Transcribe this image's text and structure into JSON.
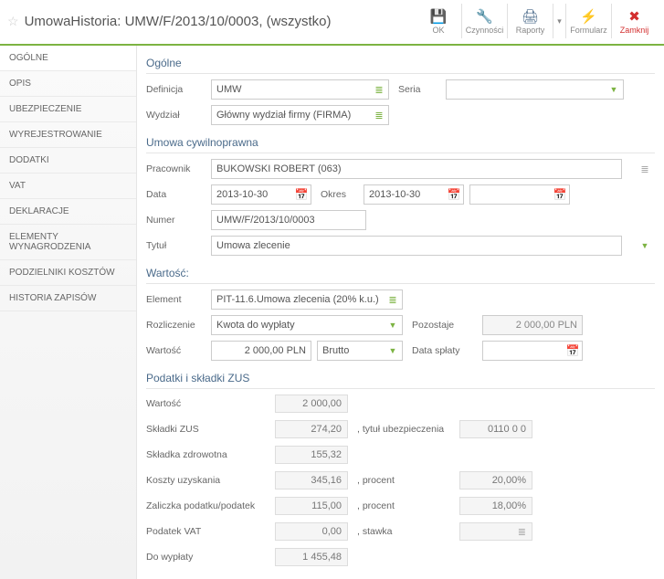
{
  "header": {
    "title": "UmowaHistoria: UMW/F/2013/10/0003, (wszystko)"
  },
  "toolbar": {
    "ok": "OK",
    "czynnosci": "Czynności",
    "raporty": "Raporty",
    "formularz": "Formularz",
    "zamknij": "Zamknij"
  },
  "sidebar": {
    "items": [
      "OGÓLNE",
      "OPIS",
      "UBEZPIECZENIE",
      "WYREJESTROWANIE",
      "DODATKI",
      "VAT",
      "DEKLARACJE",
      "ELEMENTY WYNAGRODZENIA",
      "PODZIELNIKI KOSZTÓW",
      "HISTORIA ZAPISÓW"
    ]
  },
  "sections": {
    "ogolne": "Ogólne",
    "umowa": "Umowa cywilnoprawna",
    "wartosc": "Wartość:",
    "zus": "Podatki i składki ZUS"
  },
  "labels": {
    "definicja": "Definicja",
    "seria": "Seria",
    "wydzial": "Wydział",
    "pracownik": "Pracownik",
    "data": "Data",
    "okres": "Okres",
    "numer": "Numer",
    "tytul": "Tytuł",
    "element": "Element",
    "rozliczenie": "Rozliczenie",
    "pozostaje": "Pozostaje",
    "wartosc": "Wartość",
    "data_splaty": "Data spłaty"
  },
  "values": {
    "definicja": "UMW",
    "wydzial": "Główny wydział firmy (FIRMA)",
    "pracownik": "BUKOWSKI ROBERT (063)",
    "data": "2013-10-30",
    "okres_od": "2013-10-30",
    "okres_do": "",
    "numer": "UMW/F/2013/10/0003",
    "tytul": "Umowa zlecenie",
    "element": "PIT-11.6.Umowa zlecenia (20% k.u.)",
    "rozliczenie": "Kwota do wypłaty",
    "pozostaje": "2 000,00 PLN",
    "wartosc": "2 000,00 PLN",
    "brutto": "Brutto",
    "data_splaty": ""
  },
  "zus": {
    "rows": [
      {
        "label": "Wartość",
        "v1": "2 000,00",
        "mid": "",
        "v2": ""
      },
      {
        "label": "Składki ZUS",
        "v1": "274,20",
        "mid": ", tytuł ubezpieczenia",
        "v2": "0110 0 0"
      },
      {
        "label": "Składka zdrowotna",
        "v1": "155,32",
        "mid": "",
        "v2": ""
      },
      {
        "label": "Koszty uzyskania",
        "v1": "345,16",
        "mid": ", procent",
        "v2": "20,00%"
      },
      {
        "label": "Zaliczka podatku/podatek",
        "v1": "115,00",
        "mid": ", procent",
        "v2": "18,00%"
      },
      {
        "label": "Podatek VAT",
        "v1": "0,00",
        "mid": ", stawka",
        "v2": "",
        "icon": true
      },
      {
        "label": "Do wypłaty",
        "v1": "1 455,48",
        "mid": "",
        "v2": ""
      }
    ]
  }
}
